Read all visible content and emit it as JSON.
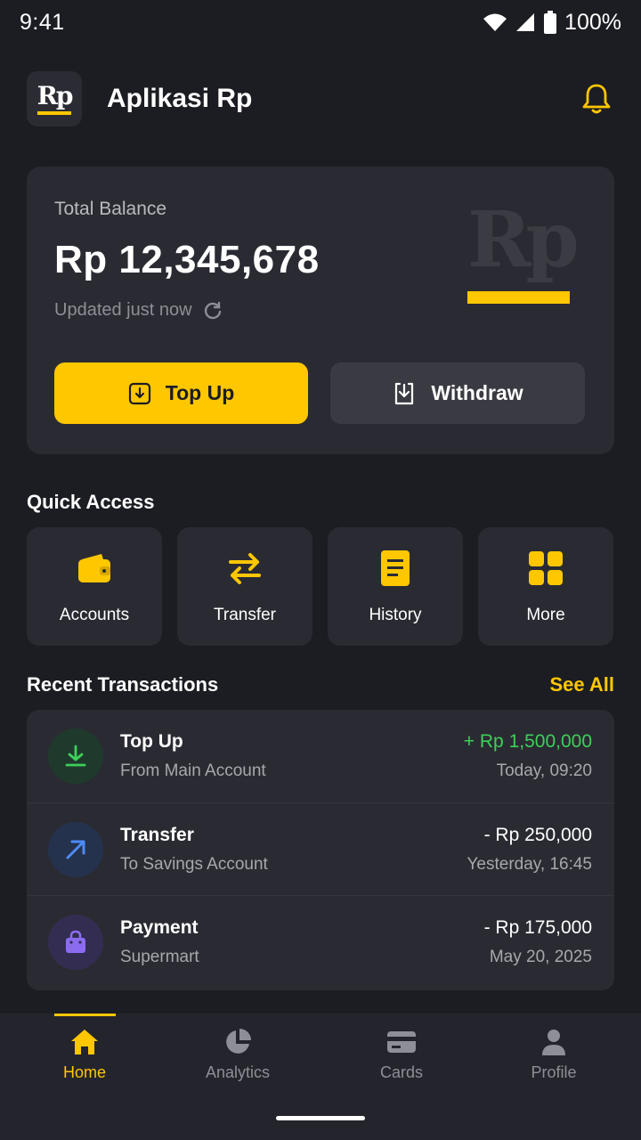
{
  "status_bar": {
    "time": "9:41",
    "battery": "100%"
  },
  "header": {
    "logo_text": "Rp",
    "title": "Aplikasi Rp"
  },
  "balance": {
    "label": "Total Balance",
    "amount": "Rp 12,345,678",
    "updated": "Updated just now",
    "watermark": "Rp",
    "topup_label": "Top Up",
    "withdraw_label": "Withdraw"
  },
  "quick_access": {
    "title": "Quick Access",
    "items": [
      {
        "label": "Accounts",
        "icon": "wallet-icon"
      },
      {
        "label": "Transfer",
        "icon": "swap-arrows-icon"
      },
      {
        "label": "History",
        "icon": "document-icon"
      },
      {
        "label": "More",
        "icon": "grid-icon"
      }
    ]
  },
  "recent": {
    "title": "Recent Transactions",
    "see_all": "See All",
    "transactions": [
      {
        "name": "Top Up",
        "sub": "From Main Account",
        "amount": "+ Rp 1,500,000",
        "date": "Today, 09:20",
        "icon": "download-arrow-icon"
      },
      {
        "name": "Transfer",
        "sub": "To Savings Account",
        "amount": "- Rp 250,000",
        "date": "Yesterday, 16:45",
        "icon": "arrow-up-right-icon"
      },
      {
        "name": "Payment",
        "sub": "Supermart",
        "amount": "- Rp 175,000",
        "date": "May 20, 2025",
        "icon": "shopping-bag-icon"
      }
    ]
  },
  "nav": {
    "items": [
      {
        "label": "Home",
        "icon": "home-icon"
      },
      {
        "label": "Analytics",
        "icon": "pie-chart-icon"
      },
      {
        "label": "Cards",
        "icon": "card-icon"
      },
      {
        "label": "Profile",
        "icon": "person-icon"
      }
    ]
  },
  "colors": {
    "accent": "#ffc700",
    "background": "#1c1d23",
    "card": "#2a2b32",
    "positive": "#3ecf5a"
  }
}
